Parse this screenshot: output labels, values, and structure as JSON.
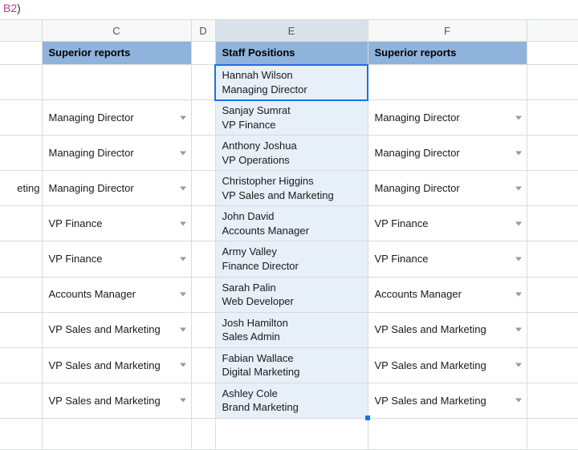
{
  "formula_fragment": {
    "ref": "B2",
    "tail": ")"
  },
  "col_headers": {
    "C": "C",
    "D": "D",
    "E": "E",
    "F": "F"
  },
  "headers": {
    "C": "Superior reports",
    "E": "Staff Positions",
    "F": "Superior reports"
  },
  "peek": {
    "row4": "eting"
  },
  "rows": [
    {
      "C": "",
      "E1": "Hannah Wilson",
      "E2": "Managing Director",
      "F": ""
    },
    {
      "C": "Managing Director",
      "E1": "Sanjay Sumrat",
      "E2": "VP Finance",
      "F": "Managing Director"
    },
    {
      "C": "Managing Director",
      "E1": "Anthony Joshua",
      "E2": "VP Operations",
      "F": "Managing Director"
    },
    {
      "C": "Managing Director",
      "E1": "Christopher Higgins",
      "E2": "VP Sales and Marketing",
      "F": "Managing Director"
    },
    {
      "C": "VP Finance",
      "E1": "John David",
      "E2": "Accounts Manager",
      "F": "VP Finance"
    },
    {
      "C": "VP Finance",
      "E1": "Army Valley",
      "E2": "Finance Director",
      "F": "VP Finance"
    },
    {
      "C": "Accounts Manager",
      "E1": "Sarah Palin",
      "E2": "Web Developer",
      "F": "Accounts Manager"
    },
    {
      "C": "VP Sales and Marketing",
      "E1": "Josh Hamilton",
      "E2": "Sales Admin",
      "F": "VP Sales and Marketing"
    },
    {
      "C": "VP Sales and Marketing",
      "E1": "Fabian Wallace",
      "E2": "Digital Marketing",
      "F": "VP Sales and Marketing"
    },
    {
      "C": "VP Sales and Marketing",
      "E1": "Ashley Cole",
      "E2": "Brand Marketing",
      "F": "VP Sales and Marketing"
    }
  ]
}
